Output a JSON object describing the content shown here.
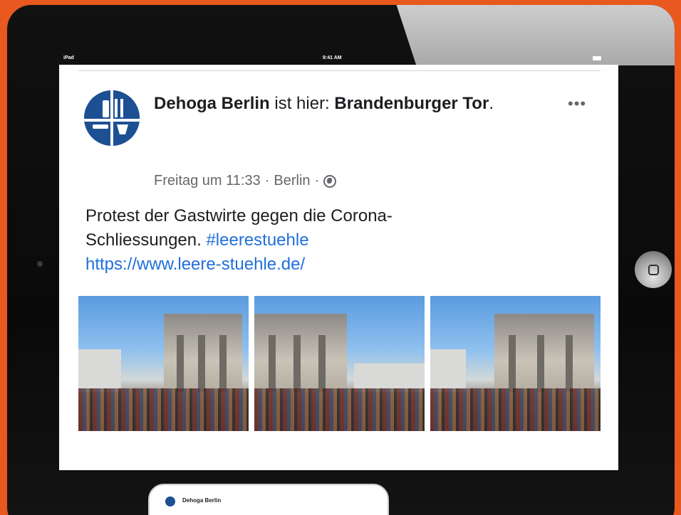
{
  "device": {
    "status_bar": {
      "carrier": "iPad",
      "time": "9:41 AM"
    }
  },
  "post": {
    "author": "Dehoga Berlin",
    "action_text": " ist hier: ",
    "location": "Brandenburger Tor",
    "location_suffix": ".",
    "timestamp": "Freitag um 11:33",
    "separator": " · ",
    "place": "Berlin",
    "separator2": " ·",
    "privacy_icon": "globe-icon",
    "more_icon": "more-options-icon",
    "more_label": "•••",
    "text_line1": "Protest der Gastwirte gegen die Corona-",
    "text_line2": "Schliessungen. ",
    "hashtag": "#leerestuehle",
    "url": "https://www.leere-stuehle.de/",
    "photo_count": 3
  },
  "mini_post": {
    "author": "Dehoga Berlin"
  },
  "colors": {
    "background": "#e8581f",
    "link": "#216fdb",
    "brand": "#1d4f93"
  }
}
